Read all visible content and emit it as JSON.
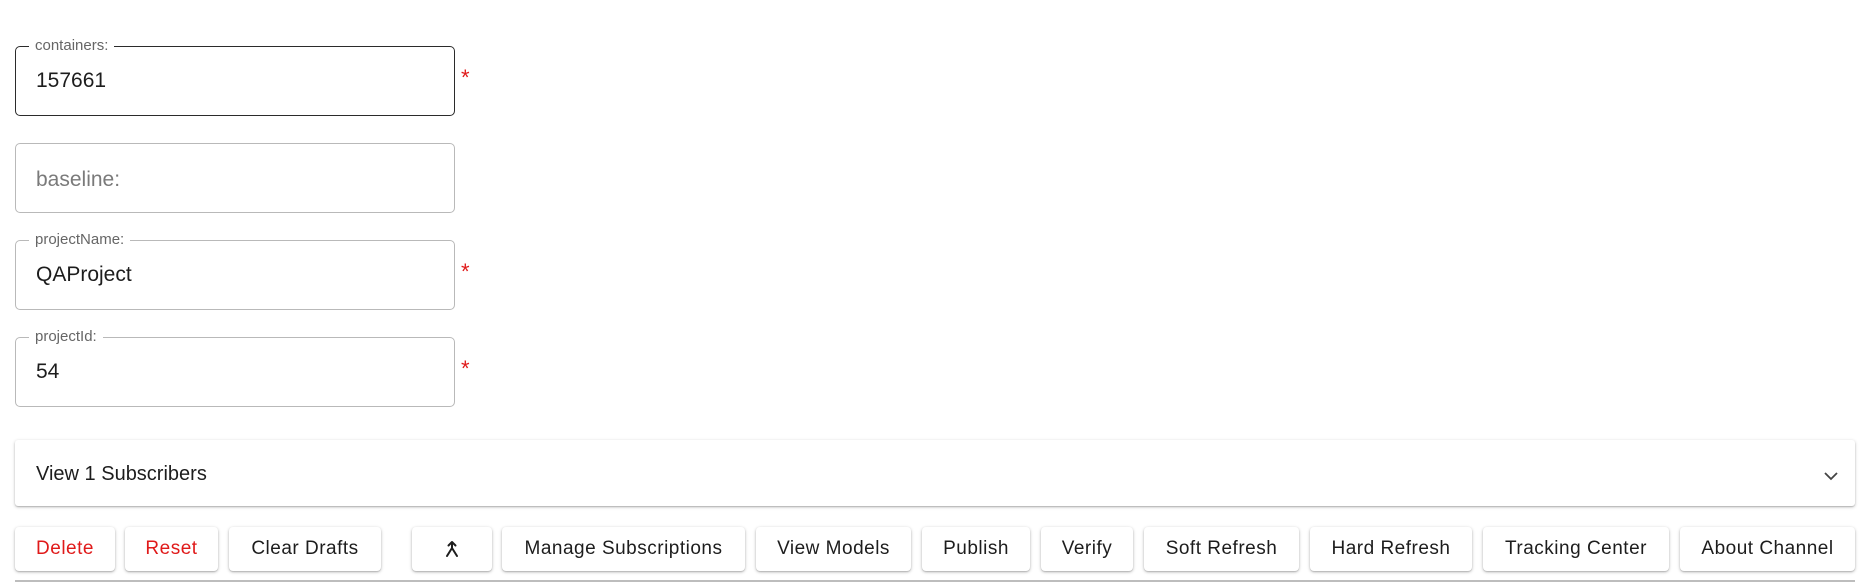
{
  "form": {
    "containers": {
      "label": "containers:",
      "value": "157661",
      "required": "*"
    },
    "baseline": {
      "placeholder": "baseline:"
    },
    "projectName": {
      "label": "projectName:",
      "value": "QAProject",
      "required": "*"
    },
    "projectId": {
      "label": "projectId:",
      "value": "54",
      "required": "*"
    }
  },
  "subscribers": {
    "title": "View 1 Subscribers",
    "icon": "chevron-down-icon"
  },
  "actions": {
    "delete_label": "Delete",
    "reset_label": "Reset",
    "clear_drafts_label": "Clear Drafts",
    "merge_icon": "merge-icon",
    "manage_subscriptions_label": "Manage Subscriptions",
    "view_models_label": "View Models",
    "publish_label": "Publish",
    "verify_label": "Verify",
    "soft_refresh_label": "Soft Refresh",
    "hard_refresh_label": "Hard Refresh",
    "tracking_center_label": "Tracking Center",
    "about_channel_label": "About Channel"
  },
  "colors": {
    "danger": "#e01a1a",
    "required": "#e01a1a",
    "border": "#b9b9b9",
    "focused_border": "#2b2b2b"
  }
}
